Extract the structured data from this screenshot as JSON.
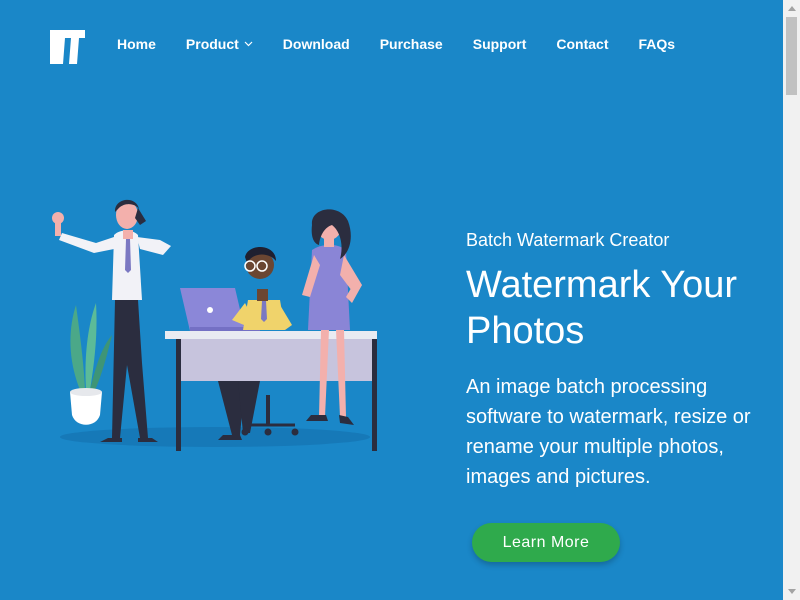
{
  "brand": {
    "logo_icon": "tt-logo-icon",
    "colors": {
      "background": "#1a87c8",
      "cta": "#2faa4c",
      "text": "#ffffff"
    }
  },
  "nav": {
    "items": [
      {
        "label": "Home"
      },
      {
        "label": "Product",
        "icon": "chevron-down-icon"
      },
      {
        "label": "Download"
      },
      {
        "label": "Purchase"
      },
      {
        "label": "Support"
      },
      {
        "label": "Contact"
      },
      {
        "label": "FAQs"
      }
    ]
  },
  "hero": {
    "subtitle": "Batch Watermark Creator",
    "title": "Watermark Your Photos",
    "description": "An image batch processing software to watermark, resize or rename your multiple photos, images and pictures.",
    "cta_label": "Learn More"
  }
}
